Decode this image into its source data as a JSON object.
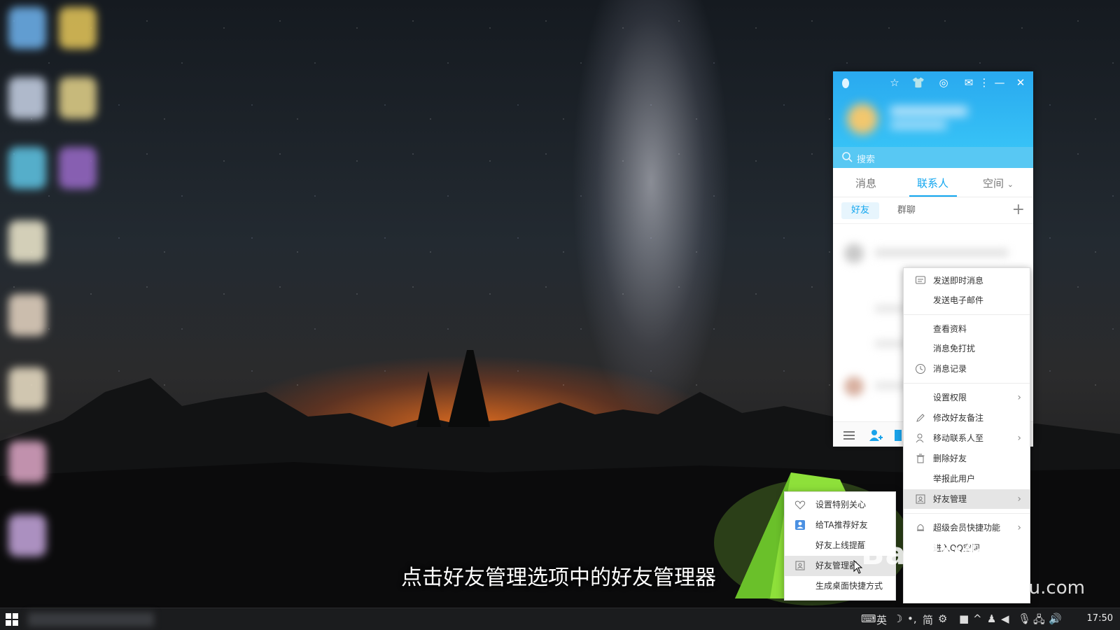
{
  "qq": {
    "search_placeholder": "搜索",
    "tabs": [
      {
        "label": "消息"
      },
      {
        "label": "联系人",
        "active": true
      },
      {
        "label": "空间"
      }
    ],
    "subtabs": [
      {
        "label": "好友",
        "active": true
      },
      {
        "label": "群聊"
      }
    ],
    "add_symbol": "+",
    "accent_color": "#12a6ef",
    "header_color": "#29a9ef"
  },
  "context_menu": {
    "items": [
      {
        "label": "发送即时消息",
        "icon": "chat-icon"
      },
      {
        "label": "发送电子邮件"
      },
      {
        "label": "查看资料"
      },
      {
        "label": "消息免打扰"
      },
      {
        "label": "消息记录",
        "icon": "clock-icon"
      },
      {
        "label": "设置权限",
        "submenu": true
      },
      {
        "label": "修改好友备注",
        "icon": "pencil-icon"
      },
      {
        "label": "移动联系人至",
        "icon": "person-icon",
        "submenu": true
      },
      {
        "label": "删除好友",
        "icon": "trash-icon"
      },
      {
        "label": "举报此用户"
      },
      {
        "label": "好友管理",
        "icon": "contact-card-icon",
        "submenu": true,
        "highlighted": true
      },
      {
        "label": "超级会员快捷功能",
        "icon": "bell-icon",
        "submenu": true
      },
      {
        "label": "进入QQ空间"
      }
    ]
  },
  "sub_menu": {
    "items": [
      {
        "label": "设置特别关心",
        "icon": "heart-icon"
      },
      {
        "label": "给TA推荐好友",
        "icon": "person-badge-icon"
      },
      {
        "label": "好友上线提醒"
      },
      {
        "label": "好友管理器",
        "icon": "contact-card-icon",
        "highlighted": true
      },
      {
        "label": "生成桌面快捷方式"
      }
    ]
  },
  "caption": "点击好友管理选项中的好友管理器",
  "watermark": {
    "brand": "Baidu经验",
    "url": "jingyan.baidu.com"
  },
  "taskbar": {
    "tray": [
      "英",
      "简"
    ],
    "clock": "17:50"
  }
}
